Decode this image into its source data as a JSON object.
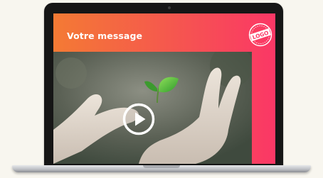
{
  "slide": {
    "title": "Votre message",
    "logo_text": "LOGO"
  },
  "video": {
    "play_label": "Play"
  },
  "colors": {
    "gradient_start": "#f47a34",
    "gradient_end": "#fb3766",
    "laptop_bezel": "#161616",
    "page_background": "#f8f6ef"
  },
  "icons": {
    "play": "play-icon",
    "logo": "logo-stamp-icon",
    "camera": "webcam-icon"
  }
}
